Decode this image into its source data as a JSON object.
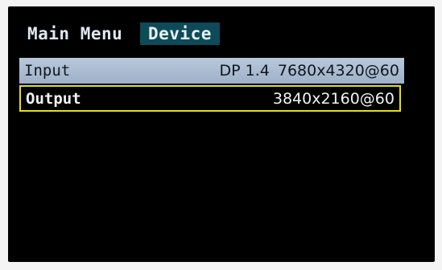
{
  "tabs": {
    "main_menu": "Main Menu",
    "device": "Device"
  },
  "rows": [
    {
      "label": "Input",
      "port": "DP 1.4",
      "resolution": "7680x4320@60"
    },
    {
      "label": "Output",
      "port": "",
      "resolution": "3840x2160@60"
    }
  ],
  "colors": {
    "screen_background": "#000000",
    "active_tab": "#0f4a58",
    "input_row_highlight": "#b8c8dc",
    "selection_border": "#e6e010"
  }
}
